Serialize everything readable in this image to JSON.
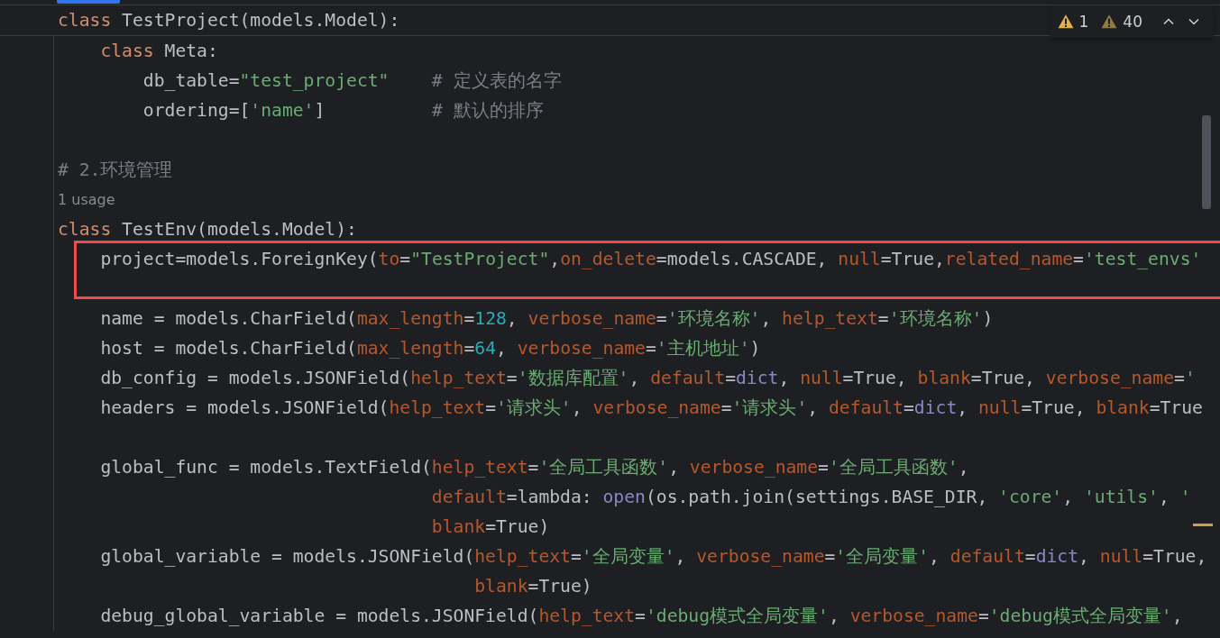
{
  "sticky_line": {
    "tokens": [
      {
        "kind": "kw",
        "text": "class"
      },
      {
        "kind": "plain",
        "text": " TestProject(models.Model):"
      }
    ]
  },
  "inspection_widget": {
    "errors": "1",
    "warnings": "40"
  },
  "lines": [
    {
      "kind": "code",
      "tokens": [
        {
          "kind": "kw",
          "text": "    class"
        },
        {
          "kind": "plain",
          "text": " Meta:"
        }
      ]
    },
    {
      "kind": "code",
      "tokens": [
        {
          "kind": "plain",
          "text": "        db_table="
        },
        {
          "kind": "str",
          "text": "\"test_project\""
        },
        {
          "kind": "comment",
          "text": "    # 定义表的名字"
        }
      ]
    },
    {
      "kind": "code",
      "tokens": [
        {
          "kind": "plain",
          "text": "        ordering=["
        },
        {
          "kind": "str",
          "text": "'name'"
        },
        {
          "kind": "plain",
          "text": "]          "
        },
        {
          "kind": "comment",
          "text": "# 默认的排序"
        }
      ]
    },
    {
      "kind": "blank"
    },
    {
      "kind": "code",
      "tokens": [
        {
          "kind": "comment",
          "text": "# 2.环境管理"
        }
      ]
    },
    {
      "kind": "usage",
      "text": "1 usage"
    },
    {
      "kind": "code",
      "tokens": [
        {
          "kind": "kw",
          "text": "class"
        },
        {
          "kind": "plain",
          "text": " TestEnv(models.Model):"
        }
      ]
    },
    {
      "kind": "code",
      "tokens": [
        {
          "kind": "plain",
          "text": "    project=models.ForeignKey("
        },
        {
          "kind": "param",
          "text": "to"
        },
        {
          "kind": "plain",
          "text": "="
        },
        {
          "kind": "str",
          "text": "\"TestProject\""
        },
        {
          "kind": "plain",
          "text": ","
        },
        {
          "kind": "param",
          "text": "on_delete"
        },
        {
          "kind": "plain",
          "text": "=models.CASCADE, "
        },
        {
          "kind": "param",
          "text": "null"
        },
        {
          "kind": "plain",
          "text": "=True,"
        },
        {
          "kind": "param",
          "text": "related_name"
        },
        {
          "kind": "plain",
          "text": "="
        },
        {
          "kind": "str",
          "text": "'test_envs'"
        }
      ]
    },
    {
      "kind": "blank"
    },
    {
      "kind": "code",
      "tokens": [
        {
          "kind": "plain",
          "text": "    name = models.CharField("
        },
        {
          "kind": "param",
          "text": "max_length"
        },
        {
          "kind": "plain",
          "text": "="
        },
        {
          "kind": "num",
          "text": "128"
        },
        {
          "kind": "plain",
          "text": ", "
        },
        {
          "kind": "param",
          "text": "verbose_name"
        },
        {
          "kind": "plain",
          "text": "="
        },
        {
          "kind": "str",
          "text": "'环境名称'"
        },
        {
          "kind": "plain",
          "text": ", "
        },
        {
          "kind": "param",
          "text": "help_text"
        },
        {
          "kind": "plain",
          "text": "="
        },
        {
          "kind": "str",
          "text": "'环境名称'"
        },
        {
          "kind": "plain",
          "text": ")"
        }
      ]
    },
    {
      "kind": "code",
      "tokens": [
        {
          "kind": "plain",
          "text": "    host = models.CharField("
        },
        {
          "kind": "param",
          "text": "max_length"
        },
        {
          "kind": "plain",
          "text": "="
        },
        {
          "kind": "num",
          "text": "64"
        },
        {
          "kind": "plain",
          "text": ", "
        },
        {
          "kind": "param",
          "text": "verbose_name"
        },
        {
          "kind": "plain",
          "text": "="
        },
        {
          "kind": "str",
          "text": "'主机地址'"
        },
        {
          "kind": "plain",
          "text": ")"
        }
      ]
    },
    {
      "kind": "code",
      "tokens": [
        {
          "kind": "plain",
          "text": "    db_config = models.JSONField("
        },
        {
          "kind": "param",
          "text": "help_text"
        },
        {
          "kind": "plain",
          "text": "="
        },
        {
          "kind": "str",
          "text": "'数据库配置'"
        },
        {
          "kind": "plain",
          "text": ", "
        },
        {
          "kind": "param",
          "text": "default"
        },
        {
          "kind": "plain",
          "text": "="
        },
        {
          "kind": "builtin",
          "text": "dict"
        },
        {
          "kind": "plain",
          "text": ", "
        },
        {
          "kind": "param",
          "text": "null"
        },
        {
          "kind": "plain",
          "text": "=True, "
        },
        {
          "kind": "param",
          "text": "blank"
        },
        {
          "kind": "plain",
          "text": "=True, "
        },
        {
          "kind": "param",
          "text": "verbose_name"
        },
        {
          "kind": "plain",
          "text": "="
        },
        {
          "kind": "str",
          "text": "'"
        }
      ]
    },
    {
      "kind": "code",
      "tokens": [
        {
          "kind": "plain",
          "text": "    headers = models.JSONField("
        },
        {
          "kind": "param",
          "text": "help_text"
        },
        {
          "kind": "plain",
          "text": "="
        },
        {
          "kind": "str",
          "text": "'请求头'"
        },
        {
          "kind": "plain",
          "text": ", "
        },
        {
          "kind": "param",
          "text": "verbose_name"
        },
        {
          "kind": "plain",
          "text": "="
        },
        {
          "kind": "str",
          "text": "'请求头'"
        },
        {
          "kind": "plain",
          "text": ", "
        },
        {
          "kind": "param",
          "text": "default"
        },
        {
          "kind": "plain",
          "text": "="
        },
        {
          "kind": "builtin",
          "text": "dict"
        },
        {
          "kind": "plain",
          "text": ", "
        },
        {
          "kind": "param",
          "text": "null"
        },
        {
          "kind": "plain",
          "text": "=True, "
        },
        {
          "kind": "param",
          "text": "blank"
        },
        {
          "kind": "plain",
          "text": "=True"
        }
      ]
    },
    {
      "kind": "blank"
    },
    {
      "kind": "code",
      "tokens": [
        {
          "kind": "plain",
          "text": "    global_func = models.TextField("
        },
        {
          "kind": "param",
          "text": "help_text"
        },
        {
          "kind": "plain",
          "text": "="
        },
        {
          "kind": "str",
          "text": "'全局工具函数'"
        },
        {
          "kind": "plain",
          "text": ", "
        },
        {
          "kind": "param",
          "text": "verbose_name"
        },
        {
          "kind": "plain",
          "text": "="
        },
        {
          "kind": "str",
          "text": "'全局工具函数'"
        },
        {
          "kind": "plain",
          "text": ","
        }
      ]
    },
    {
      "kind": "code",
      "tokens": [
        {
          "kind": "param",
          "text": "                                   default"
        },
        {
          "kind": "plain",
          "text": "=lambda: "
        },
        {
          "kind": "builtin",
          "text": "open"
        },
        {
          "kind": "plain",
          "text": "(os.path.join(settings.BASE_DIR, "
        },
        {
          "kind": "str",
          "text": "'core'"
        },
        {
          "kind": "plain",
          "text": ", "
        },
        {
          "kind": "str",
          "text": "'utils'"
        },
        {
          "kind": "plain",
          "text": ", "
        },
        {
          "kind": "str",
          "text": "'"
        }
      ]
    },
    {
      "kind": "code",
      "tokens": [
        {
          "kind": "param",
          "text": "                                   blank"
        },
        {
          "kind": "plain",
          "text": "=True)"
        }
      ]
    },
    {
      "kind": "code",
      "tokens": [
        {
          "kind": "plain",
          "text": "    global_variable = models.JSONField("
        },
        {
          "kind": "param",
          "text": "help_text"
        },
        {
          "kind": "plain",
          "text": "="
        },
        {
          "kind": "str",
          "text": "'全局变量'"
        },
        {
          "kind": "plain",
          "text": ", "
        },
        {
          "kind": "param",
          "text": "verbose_name"
        },
        {
          "kind": "plain",
          "text": "="
        },
        {
          "kind": "str",
          "text": "'全局变量'"
        },
        {
          "kind": "plain",
          "text": ", "
        },
        {
          "kind": "param",
          "text": "default"
        },
        {
          "kind": "plain",
          "text": "="
        },
        {
          "kind": "builtin",
          "text": "dict"
        },
        {
          "kind": "plain",
          "text": ", "
        },
        {
          "kind": "param",
          "text": "null"
        },
        {
          "kind": "plain",
          "text": "=True,"
        }
      ]
    },
    {
      "kind": "code",
      "tokens": [
        {
          "kind": "param",
          "text": "                                       blank"
        },
        {
          "kind": "plain",
          "text": "=True)"
        }
      ]
    },
    {
      "kind": "code",
      "tokens": [
        {
          "kind": "plain",
          "text": "    debug_global_variable = models.JSONField("
        },
        {
          "kind": "param",
          "text": "help_text"
        },
        {
          "kind": "plain",
          "text": "="
        },
        {
          "kind": "str",
          "text": "'debug模式全局变量'"
        },
        {
          "kind": "plain",
          "text": ", "
        },
        {
          "kind": "param",
          "text": "verbose_name"
        },
        {
          "kind": "plain",
          "text": "="
        },
        {
          "kind": "str",
          "text": "'debug模式全局变量'"
        },
        {
          "kind": "plain",
          "text": ","
        }
      ]
    }
  ]
}
